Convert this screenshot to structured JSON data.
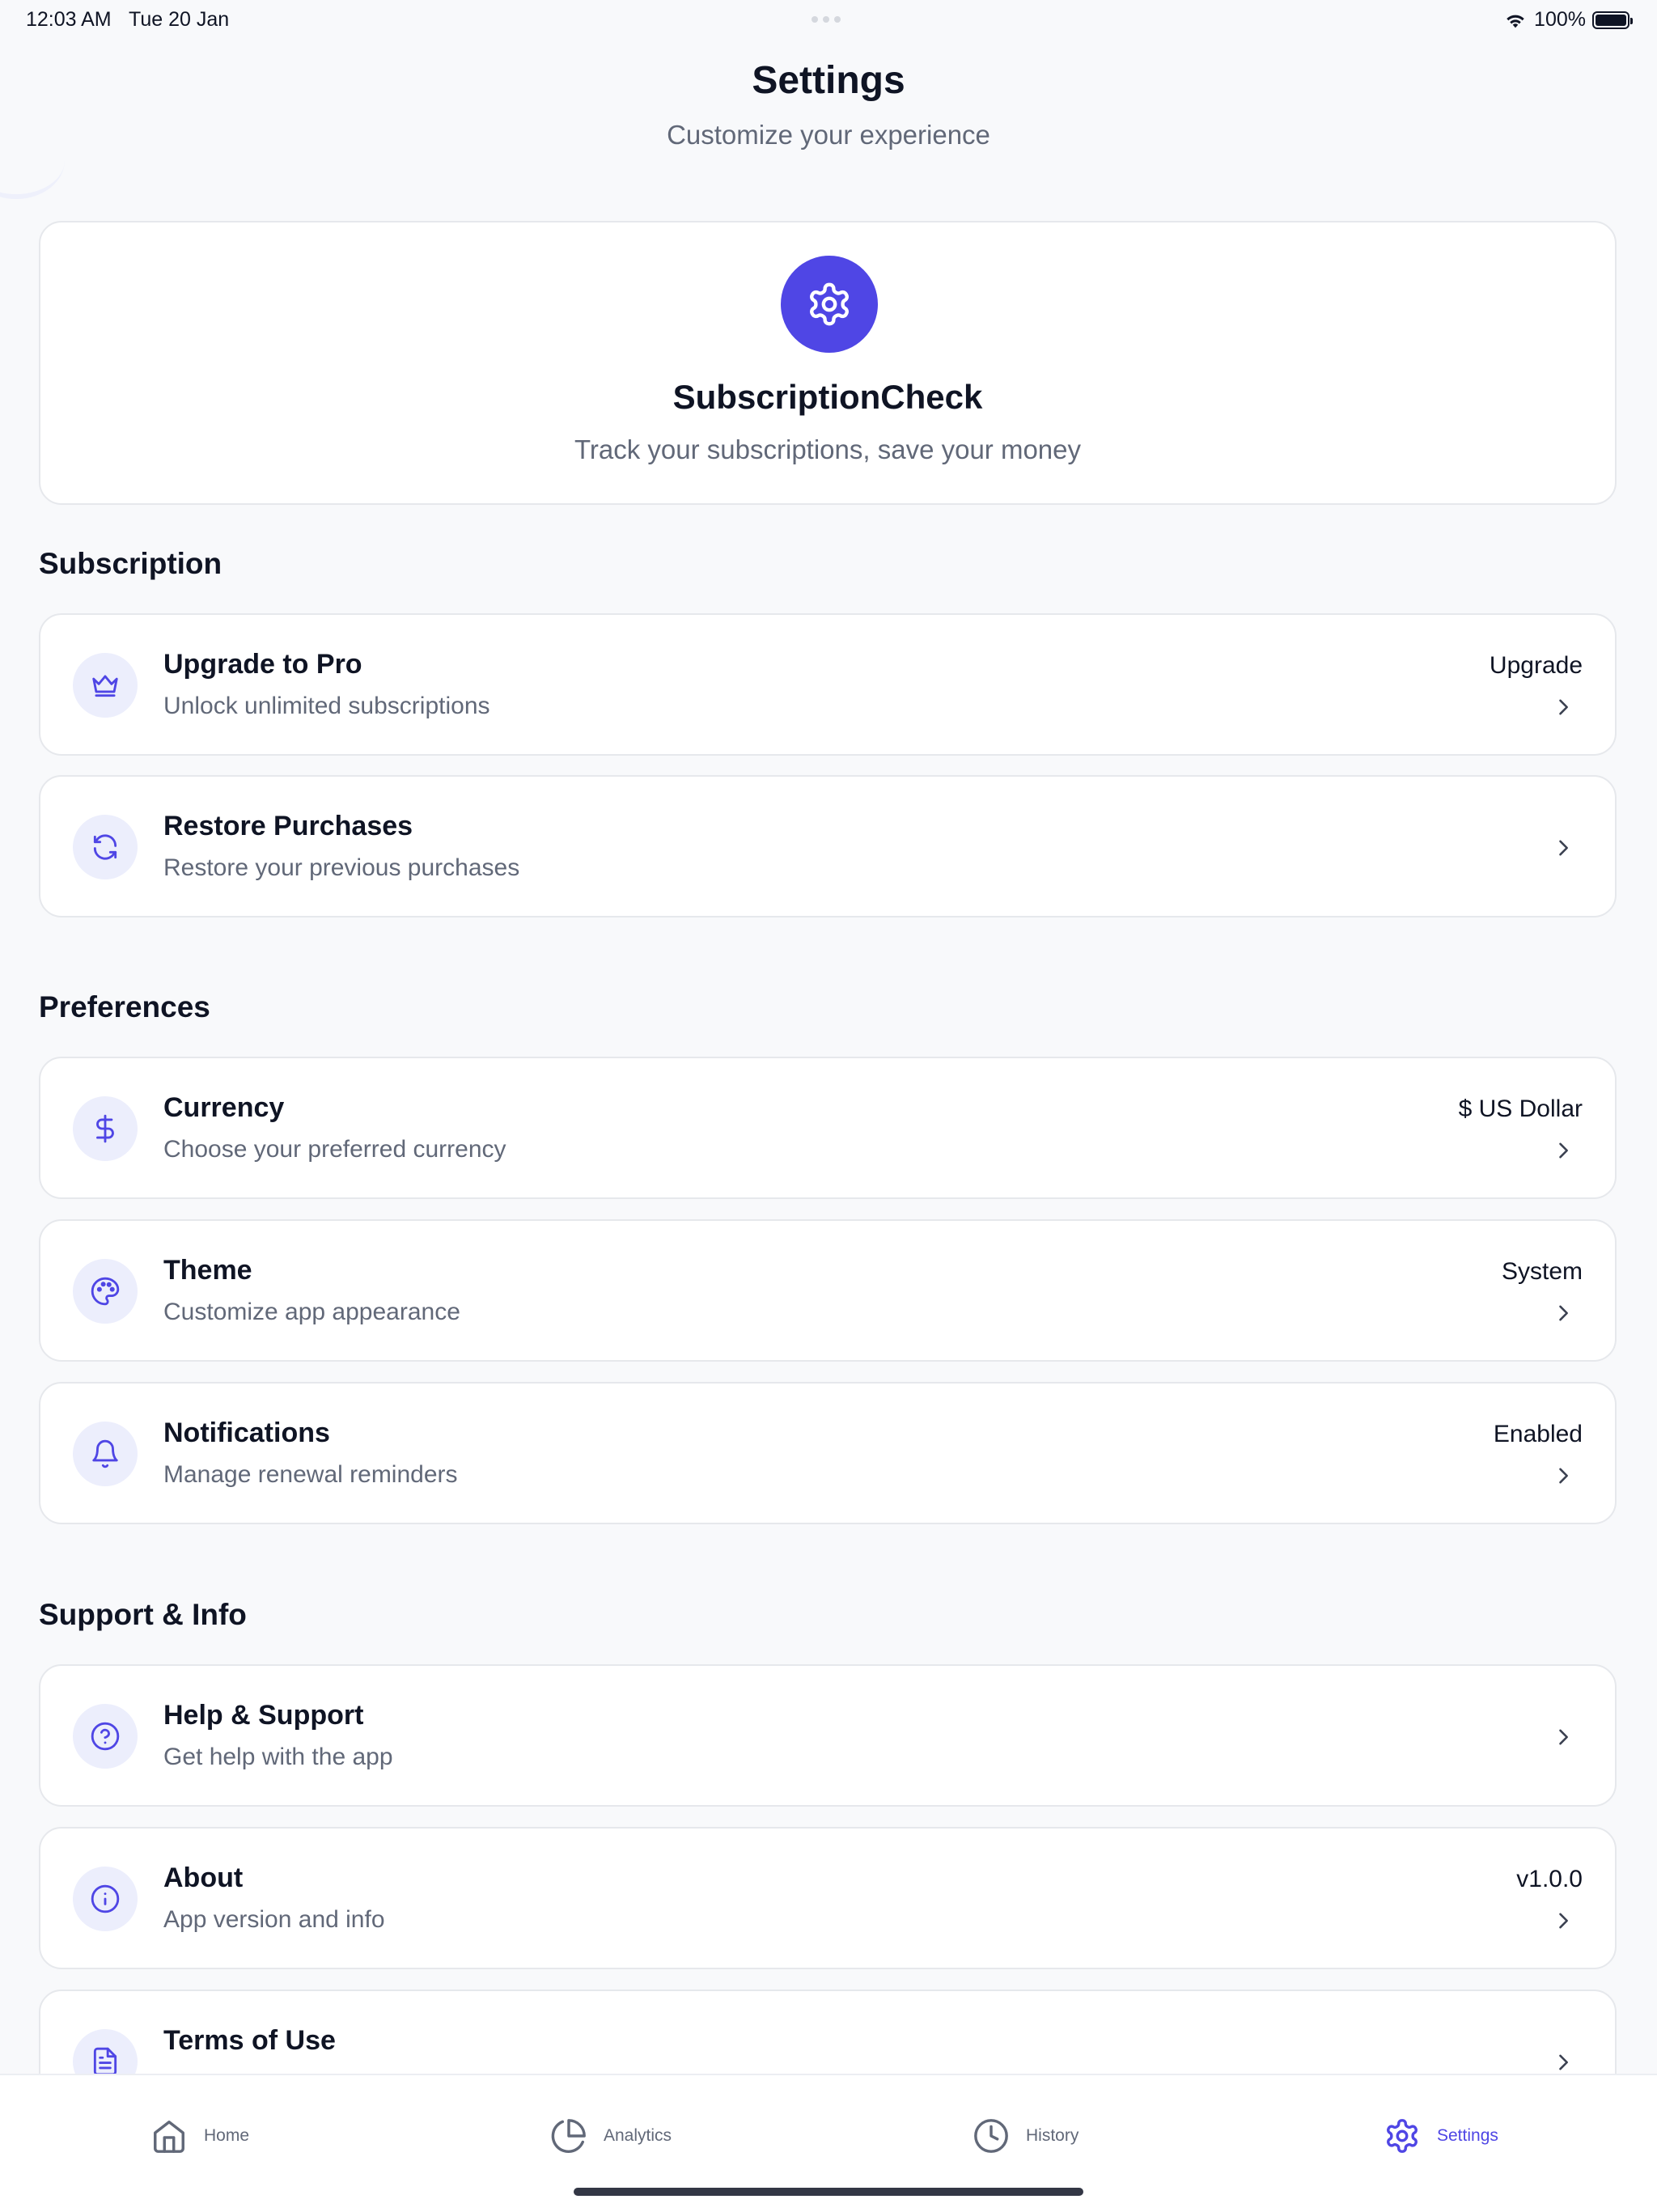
{
  "status_bar": {
    "time": "12:03 AM",
    "date": "Tue 20 Jan",
    "battery": "100%"
  },
  "header": {
    "title": "Settings",
    "subtitle": "Customize your experience"
  },
  "hero": {
    "icon": "gear-icon",
    "app_name": "SubscriptionCheck",
    "tagline": "Track your subscriptions, save your money"
  },
  "sections": [
    {
      "title": "Subscription",
      "rows": [
        {
          "icon": "crown-icon",
          "title": "Upgrade to Pro",
          "subtitle": "Unlock unlimited subscriptions",
          "value": "Upgrade"
        },
        {
          "icon": "refresh-icon",
          "title": "Restore Purchases",
          "subtitle": "Restore your previous purchases",
          "value": ""
        }
      ]
    },
    {
      "title": "Preferences",
      "rows": [
        {
          "icon": "dollar-icon",
          "title": "Currency",
          "subtitle": "Choose your preferred currency",
          "value": "$ US Dollar"
        },
        {
          "icon": "palette-icon",
          "title": "Theme",
          "subtitle": "Customize app appearance",
          "value": "System"
        },
        {
          "icon": "bell-icon",
          "title": "Notifications",
          "subtitle": "Manage renewal reminders",
          "value": "Enabled"
        }
      ]
    },
    {
      "title": "Support & Info",
      "rows": [
        {
          "icon": "help-circle-icon",
          "title": "Help & Support",
          "subtitle": "Get help with the app",
          "value": ""
        },
        {
          "icon": "info-icon",
          "title": "About",
          "subtitle": "App version and info",
          "value": "v1.0.0"
        },
        {
          "icon": "document-icon",
          "title": "Terms of Use",
          "subtitle": "",
          "value": ""
        }
      ]
    }
  ],
  "tab_bar": {
    "tabs": [
      {
        "label": "Home",
        "icon": "home-icon",
        "active": false
      },
      {
        "label": "Analytics",
        "icon": "pie-chart-icon",
        "active": false
      },
      {
        "label": "History",
        "icon": "clock-icon",
        "active": false
      },
      {
        "label": "Settings",
        "icon": "gear-icon",
        "active": true
      }
    ]
  },
  "colors": {
    "accent": "#4f46e5",
    "icon_bg": "#eceefc",
    "text_primary": "#0f1424",
    "text_secondary": "#616878",
    "background": "#f8f9fb"
  }
}
